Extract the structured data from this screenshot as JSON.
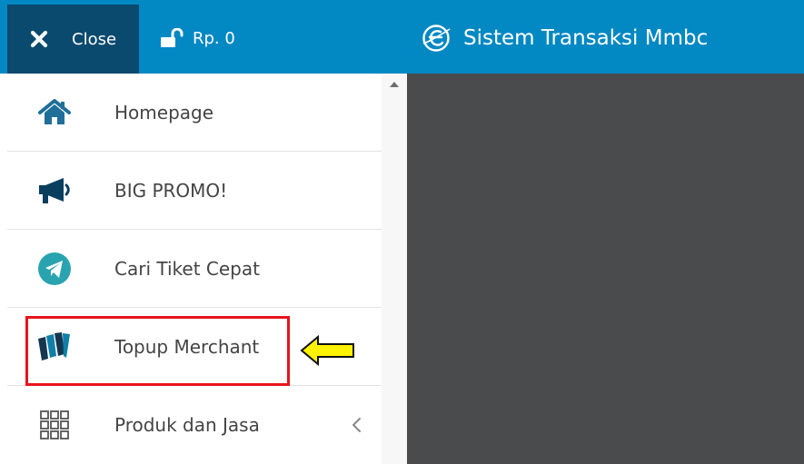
{
  "header": {
    "close_label": "Close",
    "balance_label": "Rp. 0",
    "title": "Sistem Transaksi Mmbc"
  },
  "sidebar": {
    "items": [
      {
        "label": "Homepage",
        "icon": "home-icon"
      },
      {
        "label": "BIG PROMO!",
        "icon": "megaphone-icon"
      },
      {
        "label": "Cari Tiket Cepat",
        "icon": "telegram-icon"
      },
      {
        "label": "Topup Merchant",
        "icon": "merchant-logo-icon"
      },
      {
        "label": "Produk dan Jasa",
        "icon": "grid-icon"
      }
    ]
  },
  "colors": {
    "header_bg": "#0288c3",
    "close_bg": "#0a4a6e",
    "overlay_bg": "#4a4b4d",
    "highlight_border": "#e8141c",
    "arrow_fill": "#fff200"
  }
}
